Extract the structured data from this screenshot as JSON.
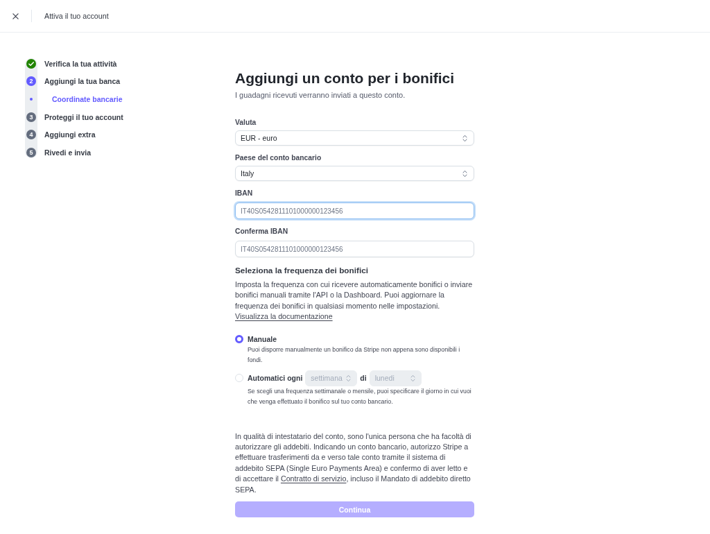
{
  "header": {
    "title": "Attiva il tuo account"
  },
  "steps": [
    {
      "label": "Verifica la tua attività",
      "completed": true
    },
    {
      "number": "2",
      "label": "Aggiungi la tua banca",
      "completed": false,
      "children": [
        {
          "label": "Coordinate bancarie",
          "selected": true
        }
      ]
    },
    {
      "number": "3",
      "label": "Proteggi il tuo account",
      "completed": false
    },
    {
      "number": "4",
      "label": "Aggiungi extra",
      "completed": false
    },
    {
      "number": "5",
      "label": "Rivedi e invia",
      "completed": false
    }
  ],
  "form": {
    "title": "Aggiungi un conto per i bonifici",
    "subtitle": "I guadagni ricevuti verranno inviati a questo conto.",
    "fields": [
      {
        "kind": "select",
        "label": "Valuta",
        "value": "EUR - euro",
        "focused": false
      },
      {
        "kind": "select",
        "label": "Paese del conto bancario",
        "value": "Italy",
        "focused": false
      },
      {
        "kind": "text",
        "label": "IBAN",
        "placeholder": "IT40S0542811101000000123456",
        "focused": true
      },
      {
        "kind": "text",
        "label": "Conferma IBAN",
        "placeholder": "IT40S0542811101000000123456",
        "focused": false
      }
    ]
  },
  "payout_schedule": {
    "heading": "Seleziona la frequenza dei bonifici",
    "description": "Imposta la frequenza con cui ricevere automaticamente bonifici o inviare bonifici manuali tramite l'API o la Dashboard. Puoi aggiornare la frequenza dei bonifici in qualsiasi momento nelle impostazioni.",
    "link": "Visualizza la documentazione",
    "options": [
      {
        "kind": "manual",
        "label": "Manuale",
        "selected": true,
        "description": "Puoi disporre manualmente un bonifico da Stripe non appena sono disponibili i fondi."
      },
      {
        "kind": "automatic",
        "label": "Automatici ogni",
        "selected": false,
        "interval_select": {
          "value": "settimana",
          "disabled": true
        },
        "joiner": "di",
        "day_select": {
          "value": "lunedi",
          "disabled": true
        },
        "description": "Se scegli una frequenza settimanale o mensile, puoi specificare il giorno in cui vuoi che venga effettuato il bonifico sul tuo conto bancario."
      }
    ]
  },
  "mandate": {
    "text_before": "In qualità di intestatario del conto, sono l'unica persona che ha facoltà di autorizzare gli addebiti. Indicando un conto bancario, autorizzo Stripe a effettuare trasferimenti da e verso tale conto tramite il sistema di addebito SEPA (Single Euro Payments Area) e confermo di aver letto e di accettare il",
    "link": "Contratto di servizio",
    "text_after": ", incluso il Mandato di addebito diretto SEPA."
  },
  "continue_button": {
    "label": "Continua",
    "disabled": true
  }
}
